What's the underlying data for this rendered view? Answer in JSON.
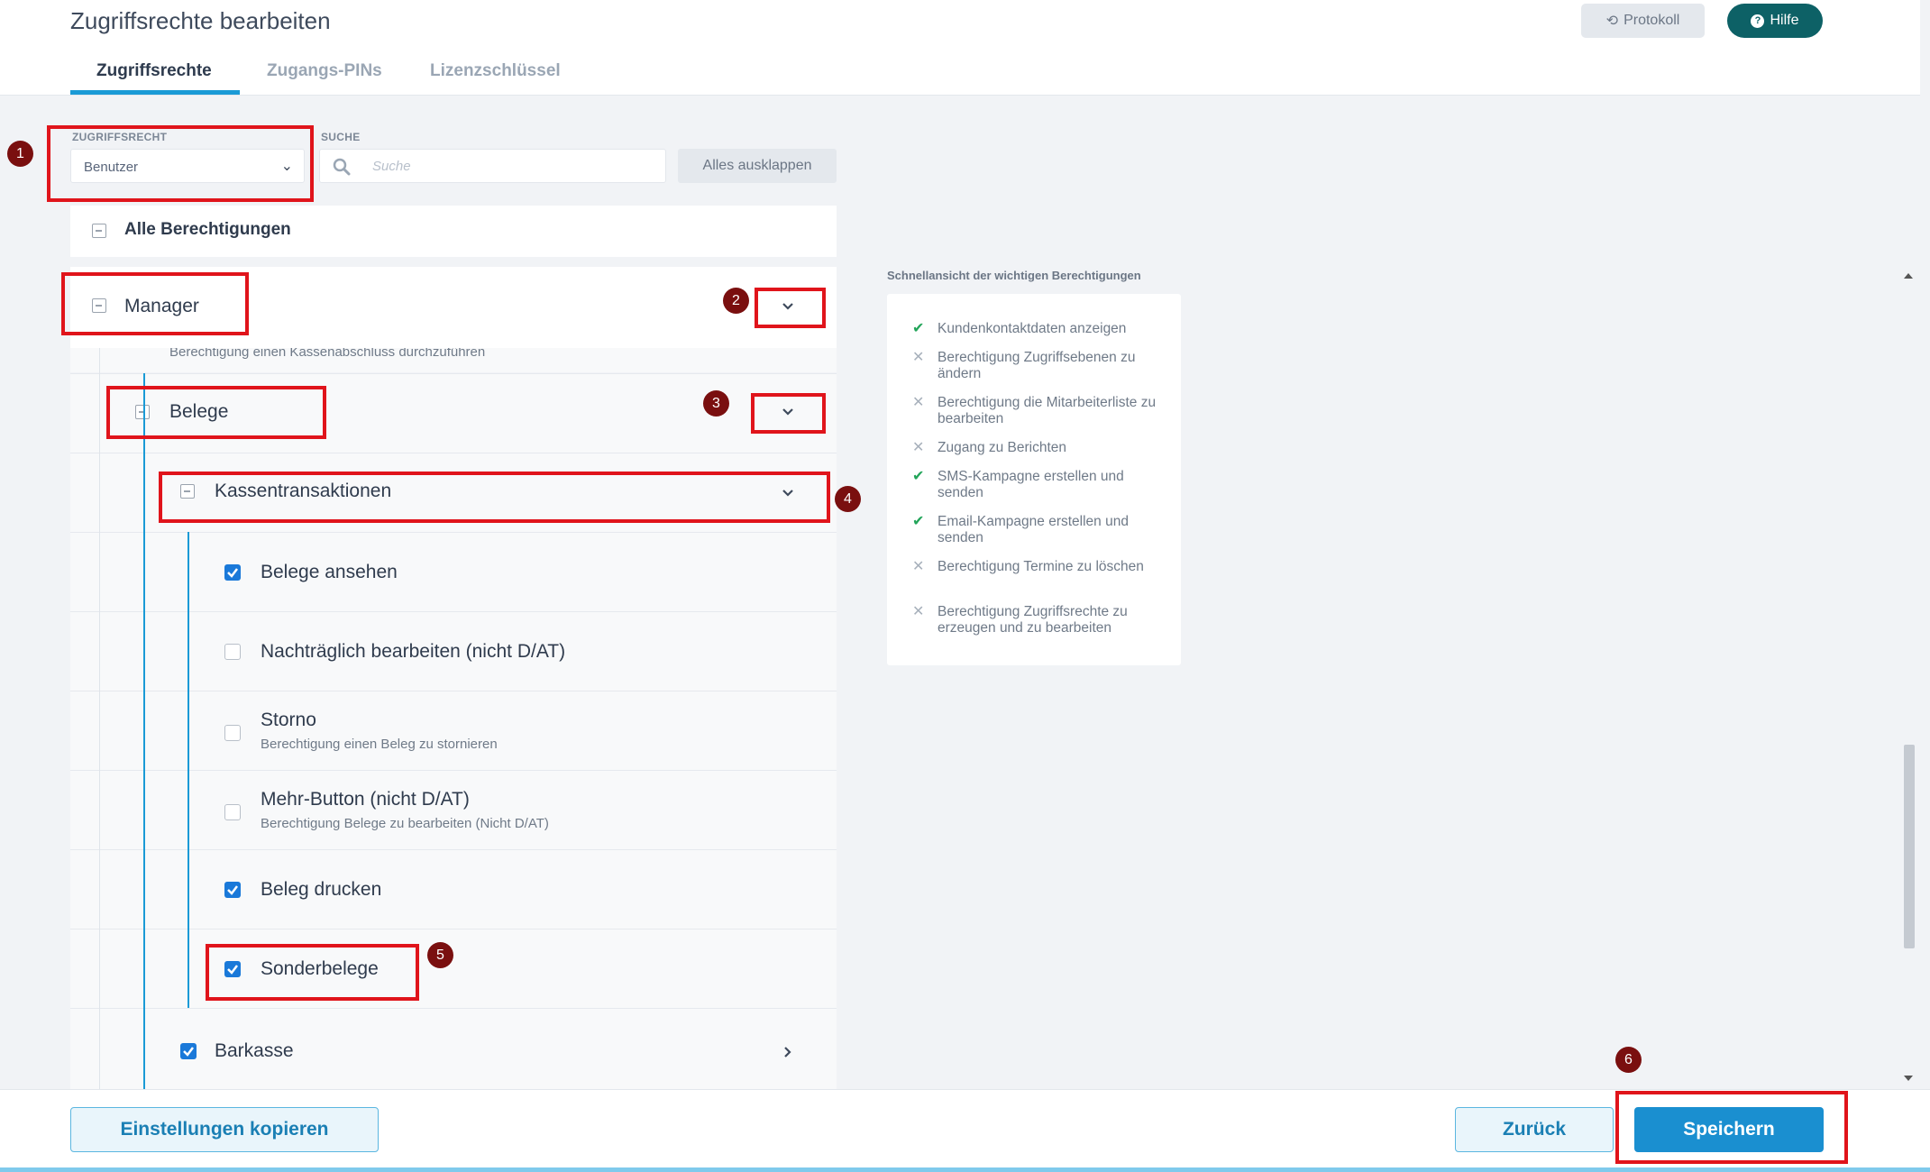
{
  "header": {
    "title": "Zugriffsrechte bearbeiten",
    "tabs": [
      {
        "label": "Zugriffsrechte",
        "active": true
      },
      {
        "label": "Zugangs-PINs",
        "active": false
      },
      {
        "label": "Lizenzschlüssel",
        "active": false
      }
    ],
    "protokoll_label": "Protokoll",
    "hilfe_label": "Hilfe",
    "protokoll_icon": "history-icon",
    "hilfe_icon": "question-circle-icon"
  },
  "filters": {
    "role_label": "ZUGRIFFSRECHT",
    "role_value": "Benutzer",
    "search_label": "SUCHE",
    "search_placeholder": "Suche",
    "expand_label": "Alles ausklappen"
  },
  "tree": {
    "all_label": "Alle Berechtigungen",
    "manager_label": "Manager",
    "manager_cut_sub": "Berechtigung einen Kassenabschluss durchzuführen",
    "belege_label": "Belege",
    "kassen_label": "Kassentransaktionen",
    "items": [
      {
        "label": "Belege ansehen",
        "sub": "",
        "checked": true
      },
      {
        "label": "Nachträglich bearbeiten (nicht D/AT)",
        "sub": "",
        "checked": false
      },
      {
        "label": "Storno",
        "sub": "Berechtigung einen Beleg zu stornieren",
        "checked": false
      },
      {
        "label": "Mehr-Button (nicht D/AT)",
        "sub": "Berechtigung Belege zu bearbeiten (Nicht D/AT)",
        "checked": false
      },
      {
        "label": "Beleg drucken",
        "sub": "",
        "checked": true
      },
      {
        "label": "Sonderbelege",
        "sub": "",
        "checked": true
      }
    ],
    "barkasse_label": "Barkasse",
    "barkasse_checked": true
  },
  "quick": {
    "title": "Schnellansicht der wichtigen Berechtigungen",
    "items": [
      {
        "text": "Kundenkontaktdaten anzeigen",
        "granted": true
      },
      {
        "text": "Berechtigung Zugriffsebenen zu ändern",
        "granted": false
      },
      {
        "text": "Berechtigung die Mitarbeiterliste zu bearbeiten",
        "granted": false
      },
      {
        "text": "Zugang zu Berichten",
        "granted": false
      },
      {
        "text": "SMS-Kampagne erstellen und senden",
        "granted": true
      },
      {
        "text": "Email-Kampagne erstellen und senden",
        "granted": true
      },
      {
        "text": "Berechtigung Termine zu löschen",
        "granted": false
      },
      {
        "text": "Berechtigung Zugriffsrechte zu erzeugen und zu bearbeiten",
        "granted": false
      }
    ]
  },
  "annotations": [
    "1",
    "2",
    "3",
    "4",
    "5",
    "6"
  ],
  "footer": {
    "copy_label": "Einstellungen kopieren",
    "back_label": "Zurück",
    "save_label": "Speichern"
  },
  "colors": {
    "accent": "#1a9ad6",
    "primary_button": "#1a8fd0",
    "help_button": "#0d6166",
    "annotation_red": "#e0141b",
    "checkbox_on": "#1a79d9"
  }
}
